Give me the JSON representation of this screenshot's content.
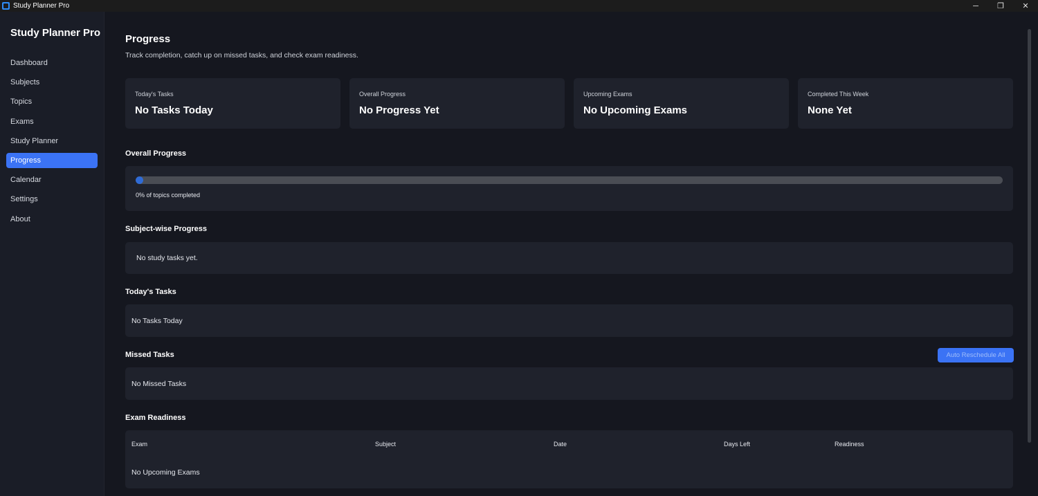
{
  "window": {
    "title": "Study Planner Pro",
    "minimize_glyph": "─",
    "maximize_glyph": "❐",
    "close_glyph": "✕"
  },
  "sidebar": {
    "brand": "Study Planner Pro",
    "items": [
      {
        "label": "Dashboard"
      },
      {
        "label": "Subjects"
      },
      {
        "label": "Topics"
      },
      {
        "label": "Exams"
      },
      {
        "label": "Study Planner"
      },
      {
        "label": "Progress",
        "active": true
      },
      {
        "label": "Calendar"
      },
      {
        "label": "Settings"
      },
      {
        "label": "About"
      }
    ]
  },
  "page": {
    "title": "Progress",
    "subtitle": "Track completion, catch up on missed tasks, and check exam readiness."
  },
  "stats": [
    {
      "label": "Today's Tasks",
      "value": "No Tasks Today"
    },
    {
      "label": "Overall Progress",
      "value": "No Progress Yet"
    },
    {
      "label": "Upcoming Exams",
      "value": "No Upcoming Exams"
    },
    {
      "label": "Completed This Week",
      "value": "None Yet"
    }
  ],
  "overall_progress": {
    "title": "Overall Progress",
    "percent": 0,
    "caption": "0% of topics completed"
  },
  "subject_progress": {
    "title": "Subject-wise Progress",
    "empty_text": "No study tasks yet."
  },
  "todays_tasks": {
    "title": "Today's Tasks",
    "empty_text": "No Tasks Today"
  },
  "missed_tasks": {
    "title": "Missed Tasks",
    "empty_text": "No Missed Tasks",
    "reschedule_label": "Auto Reschedule All"
  },
  "exam_readiness": {
    "title": "Exam Readiness",
    "columns": [
      "Exam",
      "Subject",
      "Date",
      "Days Left",
      "Readiness"
    ],
    "empty_text": "No Upcoming Exams"
  },
  "colors": {
    "accent": "#3b73f5",
    "progress_fill": "#2f6bd6",
    "background": "#15171f",
    "panel": "#1f222c"
  }
}
